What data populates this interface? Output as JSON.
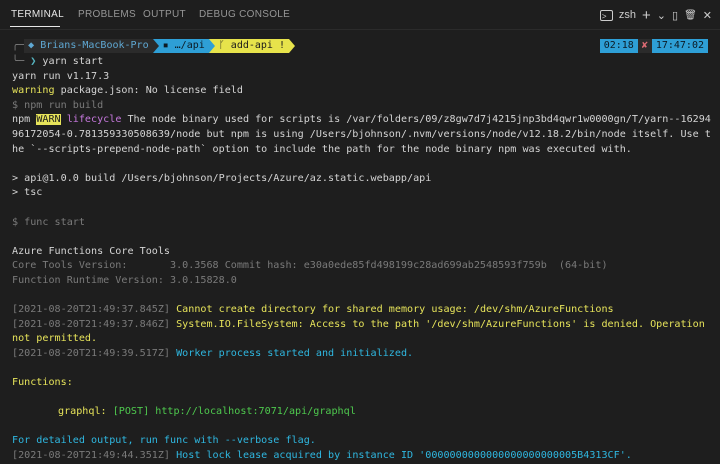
{
  "tabs": [
    "TERMINAL",
    "PROBLEMS",
    "OUTPUT",
    "DEBUG CONSOLE"
  ],
  "actions": {
    "shell_label": "zsh",
    "add_label": "+",
    "chevron": "⌄",
    "split": "▯",
    "trash": "🗑",
    "close": "✕"
  },
  "prompt": {
    "user": "Brians-MacBook-Pro",
    "dir": "…/api",
    "branch": "add-api",
    "branch_flag": "!",
    "duration": "02:18",
    "status": "✘",
    "time": "17:47:02",
    "command": "yarn start"
  },
  "lines": {
    "l1": "yarn run v1.17.3",
    "l2_label": "warning",
    "l2_text": " package.json: No license field",
    "l3": "$ npm run build",
    "l4_npm": "npm ",
    "l4_warn": "WARN",
    "l4_life": " lifecycle",
    "l4_text": " The node binary used for scripts is /var/folders/09/z8gw7d7j4215jnp3bd4qwr1w0000gn/T/yarn--1629496172054-0.781359330508639/node but npm is using /Users/bjohnson/.nvm/versions/node/v12.18.2/bin/node itself. Use the `--scripts-prepend-node-path` option to include the path for the node binary npm was executed with.",
    "l5": "> api@1.0.0 build /Users/bjohnson/Projects/Azure/az.static.webapp/api",
    "l6": "> tsc",
    "l7": "$ func start",
    "l8": "Azure Functions Core Tools",
    "l9": "Core Tools Version:       3.0.3568 Commit hash: e30a0ede85fd498199c28ad699ab2548593f759b  (64-bit)",
    "l10": "Function Runtime Version: 3.0.15828.0",
    "l11_ts": "[2021-08-20T21:49:37.845Z]",
    "l11_msg": " Cannot create directory for shared memory usage: /dev/shm/AzureFunctions",
    "l12_ts": "[2021-08-20T21:49:37.846Z]",
    "l12_msg": " System.IO.FileSystem: Access to the path '/dev/shm/AzureFunctions' is denied. Operation not permitted.",
    "l13_ts": "[2021-08-20T21:49:39.517Z]",
    "l13_msg": " Worker process started and initialized.",
    "l14": "Functions:",
    "l15_name": "graphql:",
    "l15_method": " [POST]",
    "l15_url": " http://localhost:7071/api/graphql",
    "l16": "For detailed output, run func with --verbose flag.",
    "l17_ts": "[2021-08-20T21:49:44.351Z]",
    "l17_msg": " Host lock lease acquired by instance ID '0000000000000000000000005B4313CF'."
  }
}
